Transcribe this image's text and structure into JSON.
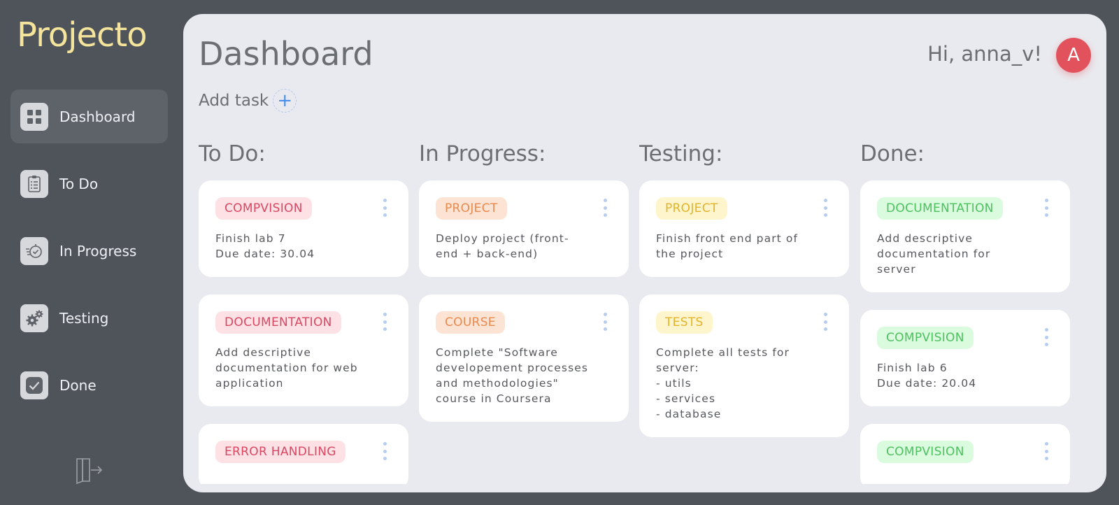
{
  "app": {
    "logo": "Projecto"
  },
  "sidebar": {
    "items": [
      {
        "label": "Dashboard",
        "icon": "dashboard-grid-icon",
        "active": true
      },
      {
        "label": "To Do",
        "icon": "clipboard-list-icon",
        "active": false
      },
      {
        "label": "In Progress",
        "icon": "stopwatch-icon",
        "active": false
      },
      {
        "label": "Testing",
        "icon": "gears-icon",
        "active": false
      },
      {
        "label": "Done",
        "icon": "checkmark-icon",
        "active": false
      }
    ],
    "logout_icon": "logout-door-icon"
  },
  "header": {
    "title": "Dashboard",
    "greeting": "Hi, anna_v!",
    "avatar_letter": "A",
    "avatar_color": "#e2525d",
    "add_task_label": "Add task",
    "add_task_symbol": "+"
  },
  "columns": [
    {
      "title": "To Do:",
      "cards": [
        {
          "tag": "COMPVISION",
          "tag_color": "pink",
          "text": "Finish lab 7\nDue date: 30.04"
        },
        {
          "tag": "DOCUMENTATION",
          "tag_color": "pink",
          "text": "Add descriptive\ndocumentation for web\napplication"
        },
        {
          "tag": "ERROR HANDLING",
          "tag_color": "pink",
          "text": ""
        }
      ]
    },
    {
      "title": "In Progress:",
      "cards": [
        {
          "tag": "PROJECT",
          "tag_color": "orange",
          "text": "Deploy project (front-\nend + back-end)"
        },
        {
          "tag": "COURSE",
          "tag_color": "orange",
          "text": "Complete \"Software\ndevelopement processes\nand methodologies\"\ncourse in Coursera"
        }
      ]
    },
    {
      "title": "Testing:",
      "cards": [
        {
          "tag": "PROJECT",
          "tag_color": "yellow",
          "text": "Finish front end part of\nthe project"
        },
        {
          "tag": "TESTS",
          "tag_color": "yellow",
          "text": "Complete all tests for\nserver:\n- utils\n- services\n- database"
        }
      ]
    },
    {
      "title": "Done:",
      "cards": [
        {
          "tag": "DOCUMENTATION",
          "tag_color": "green",
          "text": "Add descriptive\ndocumentation for\nserver"
        },
        {
          "tag": "COMPVISION",
          "tag_color": "green",
          "text": "Finish lab 6\nDue date: 20.04"
        },
        {
          "tag": "COMPVISION",
          "tag_color": "green",
          "text": ""
        }
      ]
    }
  ],
  "colors": {
    "background": "#4f535a",
    "panel": "#e9eaef",
    "logo": "#f5e49b",
    "accent_blue": "#4a8ef0"
  }
}
